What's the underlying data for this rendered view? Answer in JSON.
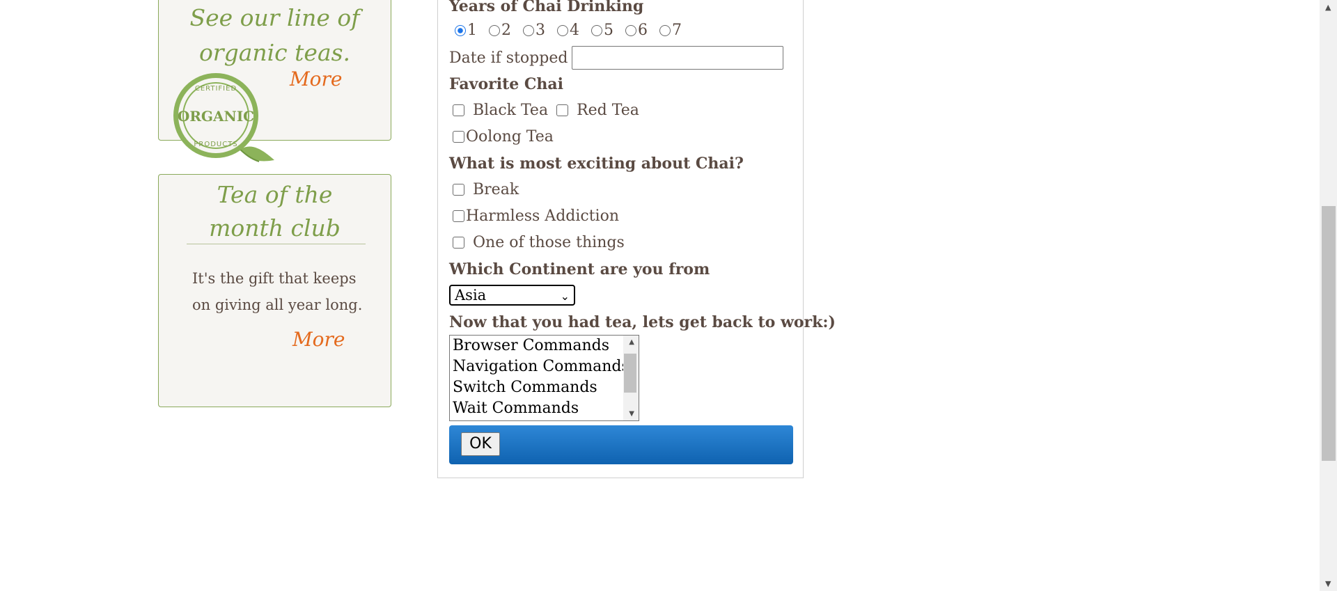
{
  "promo_organic": {
    "title_line1": "See our line of",
    "title_line2": "organic teas.",
    "more": "More",
    "seal_top": "CERTIFIED",
    "seal_main": "ORGANIC",
    "seal_bottom": "PRODUCTS"
  },
  "promo_club": {
    "title_line1": "Tea of the",
    "title_line2": "month club",
    "body": "It's the gift that keeps on giving all year long.",
    "more": "More"
  },
  "form": {
    "years_label": "Years of Chai Drinking",
    "years_options": [
      "1",
      "2",
      "3",
      "4",
      "5",
      "6",
      "7"
    ],
    "years_selected": "1",
    "date_label": "Date if stopped",
    "date_value": "",
    "favorite_label": "Favorite Chai",
    "favorite_options": [
      "Black Tea",
      "Red Tea",
      "Oolong Tea"
    ],
    "exciting_label": "What is most exciting about Chai?",
    "exciting_options": [
      "Break",
      "Harmless Addiction",
      "One of those things"
    ],
    "continent_label": "Which Continent are you from",
    "continent_selected": "Asia",
    "work_label": "Now that you had tea, lets get back to work:)",
    "commands": [
      "Browser Commands",
      "Navigation Commands",
      "Switch Commands",
      "Wait Commands"
    ],
    "ok_label": "OK"
  },
  "colors": {
    "accent_green": "#7e9e4a",
    "link_orange": "#e46a1e",
    "text_brown": "#5a4a42",
    "button_blue": "#1a6fc0"
  }
}
